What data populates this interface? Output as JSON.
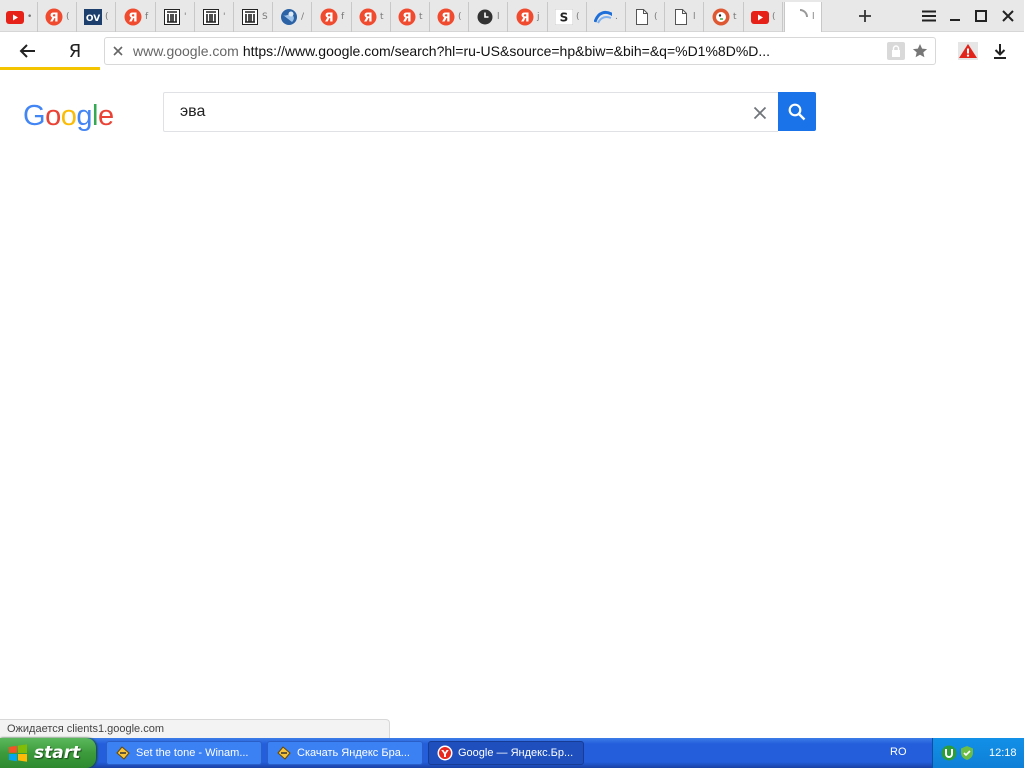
{
  "browser": {
    "tabs": [
      {
        "icon": "youtube-icon",
        "tail": "•"
      },
      {
        "icon": "yandex-icon",
        "tail": "("
      },
      {
        "icon": "ov-icon",
        "tail": "("
      },
      {
        "icon": "yandex-icon",
        "tail": "f"
      },
      {
        "icon": "museum-icon",
        "tail": "'"
      },
      {
        "icon": "museum-icon",
        "tail": "'"
      },
      {
        "icon": "museum-icon",
        "tail": "S"
      },
      {
        "icon": "globe-icon",
        "tail": "/"
      },
      {
        "icon": "yandex-icon",
        "tail": "f"
      },
      {
        "icon": "yandex-icon",
        "tail": "t"
      },
      {
        "icon": "yandex-icon",
        "tail": "t"
      },
      {
        "icon": "yandex-icon",
        "tail": "("
      },
      {
        "icon": "clock-icon",
        "tail": "l"
      },
      {
        "icon": "yandex-icon",
        "tail": "j"
      },
      {
        "icon": "s-logo-icon",
        "tail": "("
      },
      {
        "icon": "wave-icon",
        "tail": "."
      },
      {
        "icon": "page-icon",
        "tail": "("
      },
      {
        "icon": "page-icon",
        "tail": "l"
      },
      {
        "icon": "duckduckgo-icon",
        "tail": "t"
      },
      {
        "icon": "youtube-icon",
        "tail": "("
      },
      {
        "icon": "loading-icon",
        "tail": "l"
      }
    ],
    "yandex_letter": "Я",
    "address": {
      "domain": "www.google.com",
      "url": "https://www.google.com/search?hl=ru-US&source=hp&biw=&bih=&q=%D1%8D%D..."
    },
    "status_text": "Ожидается clients1.google.com"
  },
  "page": {
    "logo": {
      "letters": [
        "G",
        "o",
        "o",
        "g",
        "l",
        "e"
      ],
      "colors": [
        "#4285F4",
        "#EA4335",
        "#FBBC05",
        "#4285F4",
        "#34A853",
        "#EA4335"
      ]
    },
    "search": {
      "value": "эва",
      "placeholder": ""
    }
  },
  "taskbar": {
    "start_label": "start",
    "tasks": [
      {
        "label": "Set the tone - Winam...",
        "icon": "winamp-icon"
      },
      {
        "label": "Скачать Яндекс Бра...",
        "icon": "winamp-icon"
      },
      {
        "label": "Google — Яндекс.Бр...",
        "icon": "yandex-browser-icon"
      }
    ],
    "language": "RO",
    "clock": "12:18"
  }
}
